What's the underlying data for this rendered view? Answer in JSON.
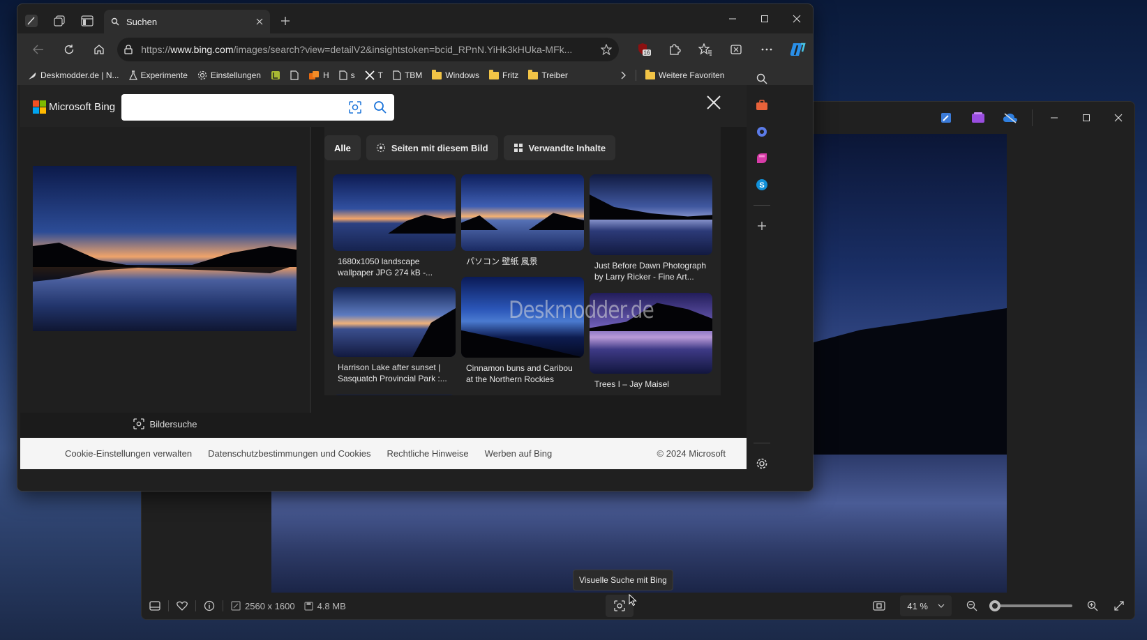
{
  "browser": {
    "tab_title": "Suchen",
    "url_prefix": "https://",
    "url_domain": "www.bing.com",
    "url_rest": "/images/search?view=detailV2&insightstoken=bcid_RPnN.YiHk3kHUka-MFk...",
    "extension_badge": "16",
    "favorites": [
      {
        "label": "Deskmodder.de | N...",
        "icon": "feather-icon"
      },
      {
        "label": "Experimente",
        "icon": "flask-icon"
      },
      {
        "label": "Einstellungen",
        "icon": "gear-icon"
      },
      {
        "label": "",
        "icon": "app-icon"
      },
      {
        "label": "",
        "icon": "page-icon"
      },
      {
        "label": "H",
        "icon": "orange-app-icon"
      },
      {
        "label": "s",
        "icon": "page-icon"
      },
      {
        "label": "T",
        "icon": "x-icon"
      },
      {
        "label": "TBM",
        "icon": "page-icon"
      },
      {
        "label": "Windows",
        "icon": "folder-icon"
      },
      {
        "label": "Fritz",
        "icon": "folder-icon"
      },
      {
        "label": "Treiber",
        "icon": "folder-icon"
      }
    ],
    "more_favorites": "Weitere Favoriten"
  },
  "bing": {
    "logo_text": "Microsoft Bing",
    "search_value": "",
    "tabs": [
      {
        "label": "Alle",
        "icon": ""
      },
      {
        "label": "Seiten mit diesem Bild",
        "icon": "pages-icon"
      },
      {
        "label": "Verwandte Inhalte",
        "icon": "grid-icon"
      }
    ],
    "results": [
      {
        "caption": "1680x1050 landscape wallpaper JPG 274 kB -..."
      },
      {
        "caption": "パソコン 壁紙 風景"
      },
      {
        "caption": "Just Before Dawn Photograph by Larry Ricker - Fine Art..."
      },
      {
        "caption": "Harrison Lake after sunset | Sasquatch Provincial Park :..."
      },
      {
        "caption": "Cinnamon buns and Caribou at the Northern Rockies"
      },
      {
        "caption": "Trees I – Jay Maisel"
      }
    ],
    "watermark": "Deskmodder.de",
    "bildersuche_label": "Bildersuche",
    "footer": {
      "cookie": "Cookie-Einstellungen verwalten",
      "privacy": "Datenschutzbestimmungen und Cookies",
      "legal": "Rechtliche Hinweise",
      "ads": "Werben auf Bing",
      "copyright": "© 2024 Microsoft"
    }
  },
  "viewer": {
    "dimensions": "2560 x 1600",
    "filesize": "4.8 MB",
    "zoom": "41 %",
    "tooltip": "Visuelle Suche mit Bing"
  }
}
